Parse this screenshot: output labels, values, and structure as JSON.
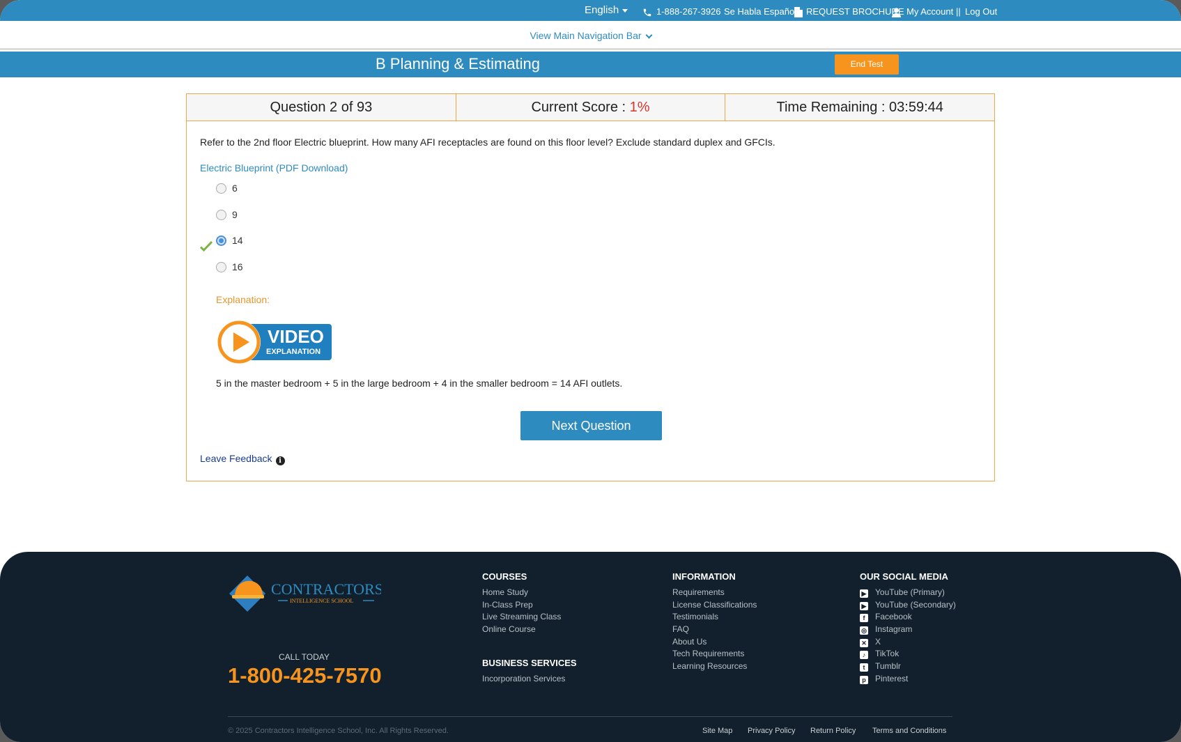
{
  "topbar": {
    "language": "English",
    "phone": "1-888-267-3926",
    "spanish": "Se Habla Español",
    "brochure": "REQUEST BROCHURE",
    "account": "My Account",
    "separator": "||",
    "logout": "Log Out"
  },
  "nav": {
    "toggle_label": "View Main Navigation Bar"
  },
  "test": {
    "title": "B Planning & Estimating",
    "end_label": "End Test",
    "question_label": "Question 2 of 93",
    "score_label": "Current Score :",
    "score_value": "1%",
    "time_label": "Time Remaining : 03:59:44"
  },
  "question": {
    "text": "Refer to the 2nd floor Electric blueprint. How many AFI receptacles are found on this floor level? Exclude standard duplex and GFCIs.",
    "blueprint_link": "Electric Blueprint (PDF Download)",
    "options": [
      "6",
      "9",
      "14",
      "16"
    ],
    "selected_index": 2,
    "correct_index": 2,
    "explanation_label": "Explanation:",
    "video_title": "VIDEO",
    "video_subtitle": "EXPLANATION",
    "answer_text": "5 in the master bedroom + 5 in the large bedroom + 4 in the smaller bedroom = 14 AFI outlets.",
    "next_label": "Next Question",
    "feedback_label": "Leave Feedback"
  },
  "footer": {
    "logo_name": "CONTRACTORS",
    "logo_sub": "INTELLIGENCE SCHOOL",
    "call_today": "CALL TODAY",
    "phone": "1-800-425-7570",
    "courses": {
      "heading": "COURSES",
      "items": [
        "Home Study",
        "In-Class Prep",
        "Live Streaming Class",
        "Online Course"
      ]
    },
    "business": {
      "heading": "BUSINESS SERVICES",
      "items": [
        "Incorporation Services"
      ]
    },
    "information": {
      "heading": "INFORMATION",
      "items": [
        "Requirements",
        "License Classifications",
        "Testimonials",
        "FAQ",
        "About Us",
        "Tech Requirements",
        "Learning Resources"
      ]
    },
    "social": {
      "heading": "OUR SOCIAL MEDIA",
      "items": [
        "YouTube (Primary)",
        "YouTube (Secondary)",
        "Facebook",
        "Instagram",
        "X",
        "TikTok",
        "Tumblr",
        "Pinterest"
      ],
      "icons": [
        "youtube-icon",
        "youtube-icon",
        "facebook-icon",
        "instagram-icon",
        "x-icon",
        "tiktok-icon",
        "tumblr-icon",
        "pinterest-icon"
      ]
    },
    "copyright": "© 2025 Contractors Intelligence School, Inc. All Rights Reserved.",
    "legal": [
      "Site Map",
      "Privacy Policy",
      "Return Policy",
      "Terms and Conditions"
    ]
  },
  "colors": {
    "brand_blue": "#2e8bc0",
    "accent_orange": "#f7941d",
    "score_red": "#d9342b",
    "footer_bg": "#11202c"
  }
}
